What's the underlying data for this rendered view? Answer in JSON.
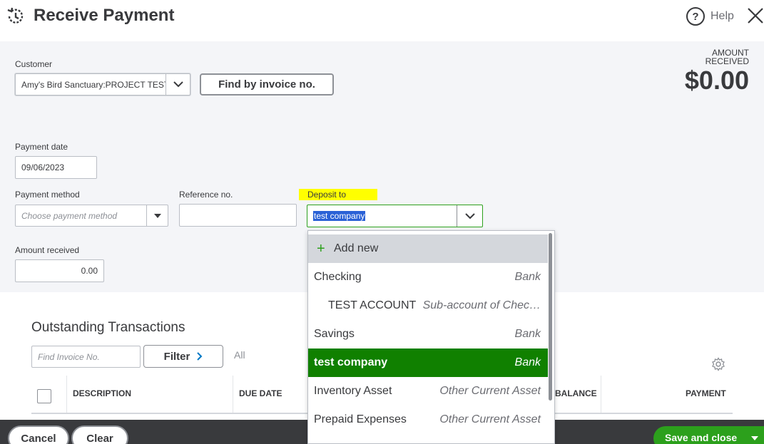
{
  "header": {
    "title": "Receive Payment",
    "help_label": "Help"
  },
  "customer": {
    "label": "Customer",
    "value": "Amy's Bird Sanctuary:PROJECT TEST",
    "find_button": "Find by invoice no."
  },
  "amount_received_header": {
    "label": "AMOUNT RECEIVED",
    "value": "$0.00"
  },
  "payment_date": {
    "label": "Payment date",
    "value": "09/06/2023"
  },
  "payment_method": {
    "label": "Payment method",
    "placeholder": "Choose payment method"
  },
  "reference": {
    "label": "Reference no.",
    "value": ""
  },
  "deposit_to": {
    "label": "Deposit to",
    "value": "test company",
    "highlight_color": "#ffff00"
  },
  "amount_received": {
    "label": "Amount received",
    "value": "0.00"
  },
  "dropdown": {
    "add_new": "Add new",
    "items": [
      {
        "name": "Checking",
        "type": "Bank"
      },
      {
        "name": "TEST ACCOUNT",
        "type": "Sub-account of Chec…"
      },
      {
        "name": "Savings",
        "type": "Bank"
      },
      {
        "name": "test company",
        "type": "Bank"
      },
      {
        "name": "Inventory Asset",
        "type": "Other Current Asset"
      },
      {
        "name": "Prepaid Expenses",
        "type": "Other Current Asset"
      }
    ],
    "selected_color": "#108000"
  },
  "outstanding": {
    "title": "Outstanding Transactions",
    "find_placeholder": "Find Invoice No.",
    "filter_label": "Filter",
    "all_label": "All",
    "columns": [
      "DESCRIPTION",
      "DUE DATE",
      "BALANCE",
      "PAYMENT"
    ]
  },
  "footer": {
    "cancel": "Cancel",
    "clear": "Clear",
    "save_close": "Save and close"
  },
  "colors": {
    "brand_green": "#2ca01c",
    "form_bg": "#f4f5f8",
    "footer_bg": "#393a3d"
  }
}
